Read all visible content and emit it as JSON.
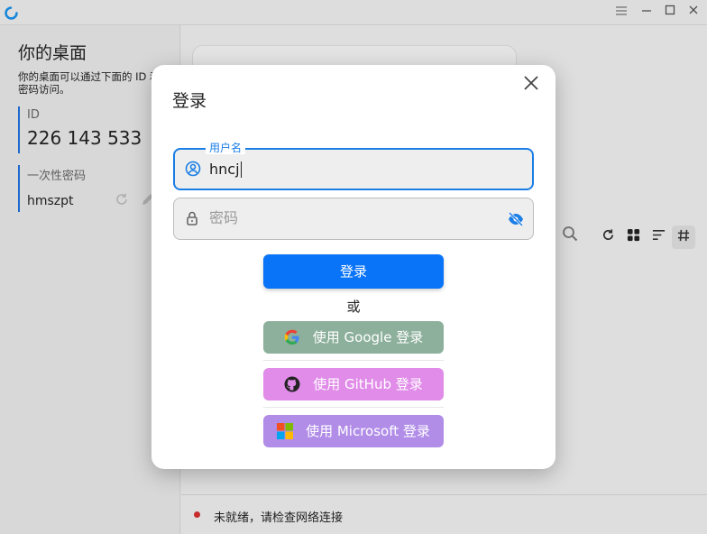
{
  "titlebar": {
    "icons": [
      "app-logo-icon",
      "menu-icon",
      "minimize-icon",
      "maximize-icon",
      "close-icon"
    ]
  },
  "left_panel": {
    "title": "你的桌面",
    "description": "你的桌面可以通过下面的 ID 和密码访问。",
    "id_label": "ID",
    "id_value": "226 143 533",
    "password_label": "一次性密码",
    "password_value": "hmszpt"
  },
  "toolbar": {
    "icons": [
      "search-icon",
      "refresh-icon",
      "grid-view-icon",
      "sort-icon",
      "hash-icon"
    ]
  },
  "status": {
    "text": "未就绪，请检查网络连接",
    "color": "#d32f2f"
  },
  "dialog": {
    "title": "登录",
    "username_label": "用户名",
    "username_value": "hncj",
    "password_placeholder": "密码",
    "login_button": "登录",
    "or_text": "或",
    "google_button": "使用 Google 登录",
    "github_button": "使用 GitHub 登录",
    "microsoft_button": "使用 Microsoft 登录"
  },
  "colors": {
    "accent": "#1b7ee6",
    "login_button": "#0a74f8",
    "google_button": "#8db09c",
    "github_button": "#e08ce8",
    "microsoft_button": "#b18de8"
  }
}
